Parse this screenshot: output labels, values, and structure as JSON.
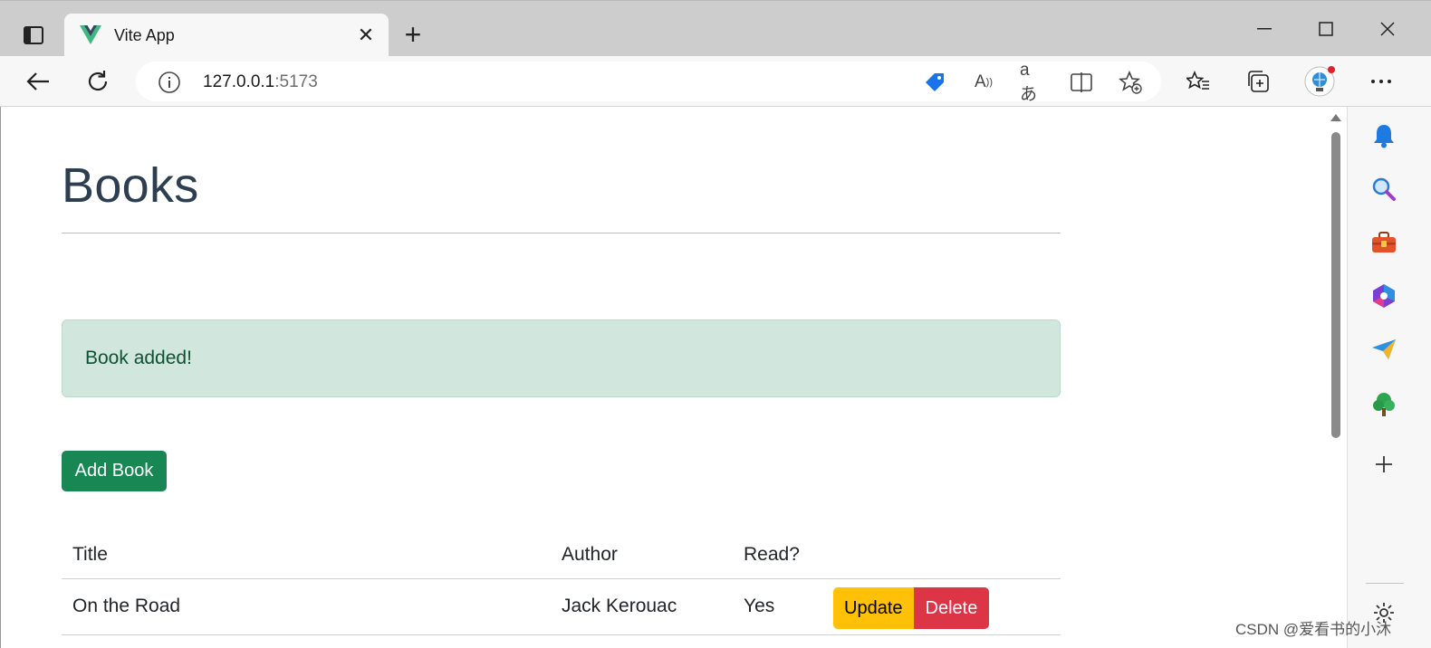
{
  "browser": {
    "tab": {
      "title": "Vite App"
    },
    "address": {
      "host": "127.0.0.1",
      "port": ":5173"
    }
  },
  "page": {
    "title": "Books",
    "alert": "Book added!",
    "add_button": "Add Book",
    "table": {
      "headers": [
        "Title",
        "Author",
        "Read?",
        ""
      ],
      "rows": [
        {
          "title": "On the Road",
          "author": "Jack Kerouac",
          "read": "Yes",
          "update": "Update",
          "delete": "Delete"
        }
      ]
    }
  },
  "sidebar": {
    "icons": [
      "bell-icon",
      "search-icon",
      "toolbox-icon",
      "office-icon",
      "send-icon",
      "tree-icon",
      "add-icon",
      "settings-icon"
    ]
  },
  "watermark": "CSDN @爱看书的小沐",
  "colors": {
    "title": "#2c3e50",
    "alert_bg": "#d1e7dd",
    "alert_text": "#0f5132",
    "success": "#198754",
    "warning": "#ffc107",
    "danger": "#dc3545"
  }
}
